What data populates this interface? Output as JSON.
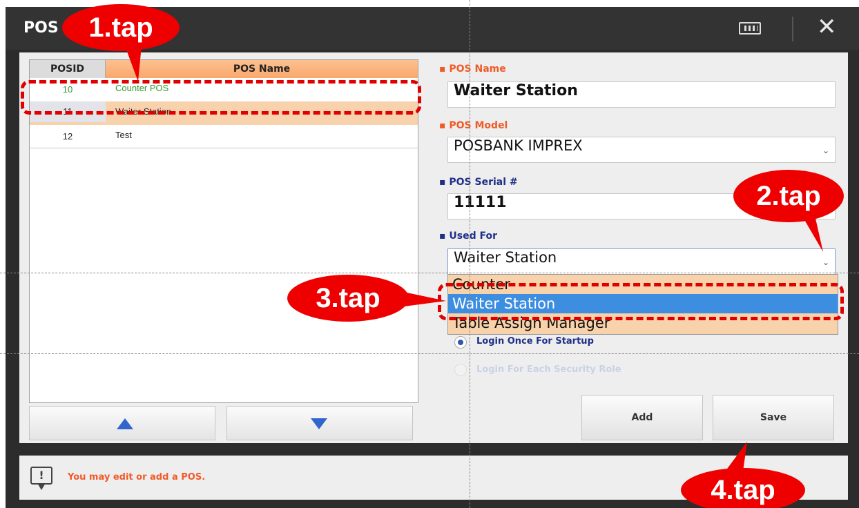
{
  "window": {
    "title": "POS",
    "keyboard_icon": "keyboard-icon",
    "close_icon": "close-icon"
  },
  "table": {
    "headers": {
      "id": "POSID",
      "name": "POS Name"
    },
    "rows": [
      {
        "id": "10",
        "name": "Counter POS"
      },
      {
        "id": "11",
        "name": "Waiter Station"
      },
      {
        "id": "12",
        "name": "Test"
      }
    ],
    "up_icon": "triangle-up-icon",
    "down_icon": "triangle-down-icon"
  },
  "form": {
    "pos_name_label": "POS Name",
    "pos_name_value": "Waiter Station",
    "pos_model_label": "POS Model",
    "pos_model_value": "POSBANK IMPREX",
    "serial_label": "POS Serial #",
    "serial_value": "11111",
    "used_for_label": "Used For",
    "used_for_value": "Waiter Station",
    "used_for_options": [
      "Counter",
      "Waiter Station",
      "Table Assign Manager"
    ],
    "login_once_label": "Login Once For Startup",
    "login_each_label": "Login For Each Security Role",
    "add_label": "Add",
    "save_label": "Save"
  },
  "footer": {
    "message": "You may edit or add a POS."
  },
  "annotations": {
    "step1": "1.tap",
    "step2": "2.tap",
    "step3": "3.tap",
    "step4": "4.tap",
    "color": "#ee0000"
  },
  "colors": {
    "accent_orange": "#f05a28",
    "label_blue": "#1f2f86",
    "selected_option": "#3d8ee0",
    "row_selected": "#f7d2ad"
  }
}
